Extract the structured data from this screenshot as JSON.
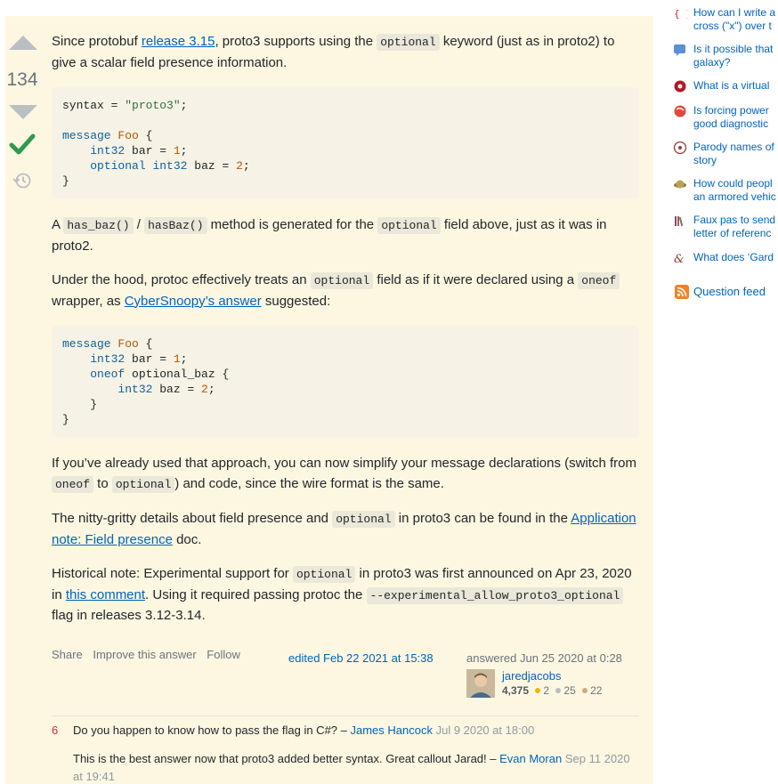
{
  "answer": {
    "vote_count": "134",
    "paragraph1": {
      "before": "Since protobuf ",
      "link": "release 3.15",
      "mid": ", proto3 supports using the ",
      "code": "optional",
      "after": " keyword (just as in proto2) to give a scalar field presence information."
    },
    "code_block1": {
      "line1_plain": "syntax = ",
      "line1_string": "\"proto3\"",
      "line1_end": ";",
      "line3_kw": "message",
      "line3_type": "Foo",
      "line3_end": " {",
      "line4_type": "int32",
      "line4_mid": " bar = ",
      "line4_num": "1",
      "line4_end": ";",
      "line5_kw": "optional",
      "line5_type": "int32",
      "line5_mid": " baz = ",
      "line5_num": "2",
      "line5_end": ";",
      "line6": "}"
    },
    "paragraph2": {
      "before": "A ",
      "code1": "has_baz()",
      "sep": " / ",
      "code2": "hasBaz()",
      "mid": " method is generated for the ",
      "code3": "optional",
      "after": " field above, just as it was in proto2."
    },
    "paragraph3": {
      "before": "Under the hood, protoc effectively treats an ",
      "code1": "optional",
      "mid": " field as if it were declared using a ",
      "code2": "oneof",
      "mid2": " wrapper, as ",
      "link": "CyberSnoopy’s answer",
      "after": " suggested:"
    },
    "code_block2": {
      "l1_kw": "message",
      "l1_type": "Foo",
      "l1_end": " {",
      "l2_type": "int32",
      "l2_mid": " bar = ",
      "l2_num": "1",
      "l2_end": ";",
      "l3_kw": "oneof",
      "l3_end": " optional_baz {",
      "l4_type": "int32",
      "l4_mid": " baz = ",
      "l4_num": "2",
      "l4_end": ";",
      "l5": "}",
      "l6": "}"
    },
    "paragraph4": {
      "before": "If you’ve already used that approach, you can now simplify your message declarations (switch from ",
      "code1": "oneof",
      "mid": " to ",
      "code2": "optional",
      "after": ") and code, since the wire format is the same."
    },
    "paragraph5": {
      "before": "The nitty-gritty details about field presence and ",
      "code": "optional",
      "mid": " in proto3 can be found in the ",
      "link": "Application note: Field presence",
      "after": " doc."
    },
    "paragraph6": {
      "before": "Historical note: Experimental support for ",
      "code1": "optional",
      "mid": " in proto3 was first announced on Apr 23, 2020 in ",
      "link": "this comment",
      "mid2": ". Using it required passing protoc the ",
      "code2": "--experimental_allow_proto3_optional",
      "after": " flag in releases 3.12-3.14."
    },
    "menu": {
      "share": "Share",
      "improve": "Improve this answer",
      "follow": "Follow"
    },
    "edited": "edited Feb 22 2021 at 15:38",
    "answered": "answered Jun 25 2020 at 0:28",
    "user": {
      "name": "jaredjacobs",
      "rep": "4,375",
      "gold": "2",
      "silver": "25",
      "bronze": "22"
    }
  },
  "comments": [
    {
      "score": "6",
      "text": "Do you happen to know how to pass the flag in C#? – ",
      "user": "James Hancock",
      "date": "Jul 9 2020 at 18:00"
    },
    {
      "score": "",
      "text": "This is the best answer now that proto3 added better syntax. Great callout Jarad! – ",
      "user": "Evan Moran",
      "date": "Sep 11 2020 at 19:41"
    }
  ],
  "sidebar": {
    "items": [
      {
        "icon": "curly-braces-icon",
        "text": "How can I write a\ncross (\"x\") over t"
      },
      {
        "icon": "chat-bubble-icon",
        "text": "Is it possible that\ngalaxy?"
      },
      {
        "icon": "gear-flower-icon",
        "text": "What is a virtual"
      },
      {
        "icon": "red-globe-icon",
        "text": "Is forcing power \ngood diagnostic"
      },
      {
        "icon": "circle-glyph-icon",
        "text": "Parody names of\nstory"
      },
      {
        "icon": "planet-icon",
        "text": "How could peopl\nan armored vehic"
      },
      {
        "icon": "books-icon",
        "text": "Faux pas to send\nletter of referenc"
      },
      {
        "icon": "ampersand-icon",
        "text": "What does ‘Gard"
      }
    ],
    "feed": "Question feed"
  },
  "colors": {
    "accepted": "#2f9a4f",
    "link": "#0063bf",
    "answer_bg": "#fdf7e2",
    "gold": "#f1b600",
    "silver": "#b8bdc2",
    "bronze": "#d1a684"
  }
}
